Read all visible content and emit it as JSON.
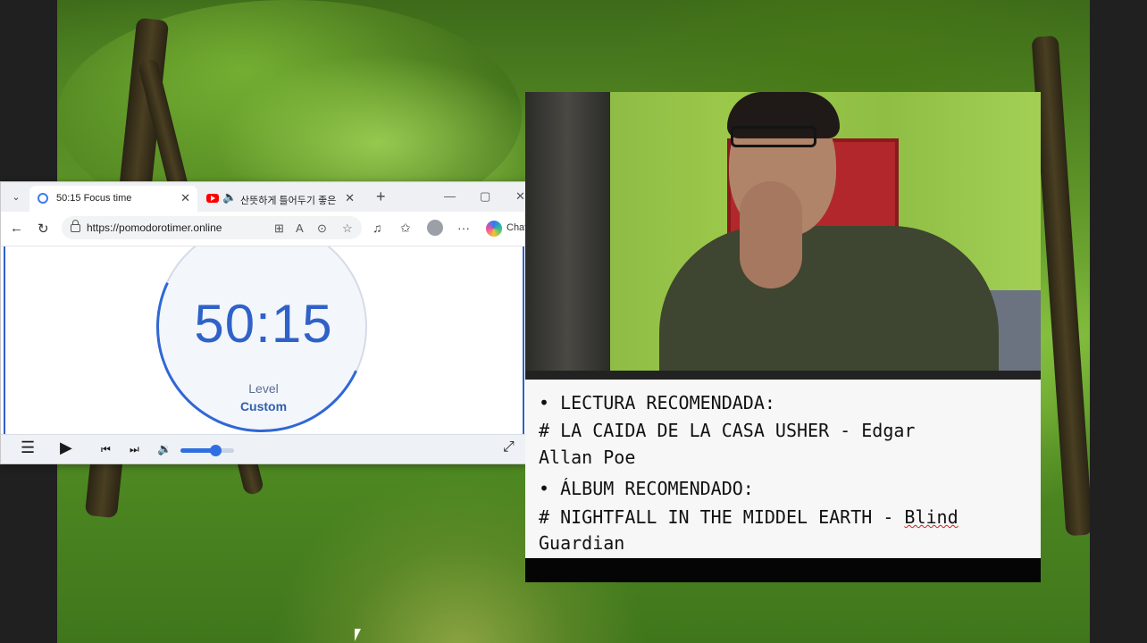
{
  "browser": {
    "tabs": [
      {
        "title": "50:15 Focus time",
        "active": true
      },
      {
        "title": "산뜻하게 틀어두기 좋은",
        "active": false
      }
    ],
    "new_tab_symbol": "+",
    "url": "https://pomodorotimer.online",
    "chat_label": "Chat",
    "window_controls": [
      "—",
      "▢",
      "✕"
    ]
  },
  "timer": {
    "value": "50:15",
    "level_label": "Level",
    "level_value": "Custom",
    "volume_percent": 65
  },
  "notes": {
    "lines": [
      "• LECTURA RECOMENDADA:",
      "# LA CAIDA DE LA CASA USHER - Edgar",
      "Allan Poe",
      "• ÁLBUM RECOMENDADO:",
      "# NIGHTFALL IN THE MIDDEL EARTH - ",
      "Blind",
      "Guardian"
    ]
  },
  "icons": {
    "menu": "hamburger-icon",
    "play": "play-icon",
    "previous": "previous-icon",
    "next": "next-icon",
    "volume": "volume-icon",
    "fullscreen": "fullscreen-icon"
  },
  "colors": {
    "timer_blue": "#2f62c9",
    "accent": "#2f6fe0"
  }
}
